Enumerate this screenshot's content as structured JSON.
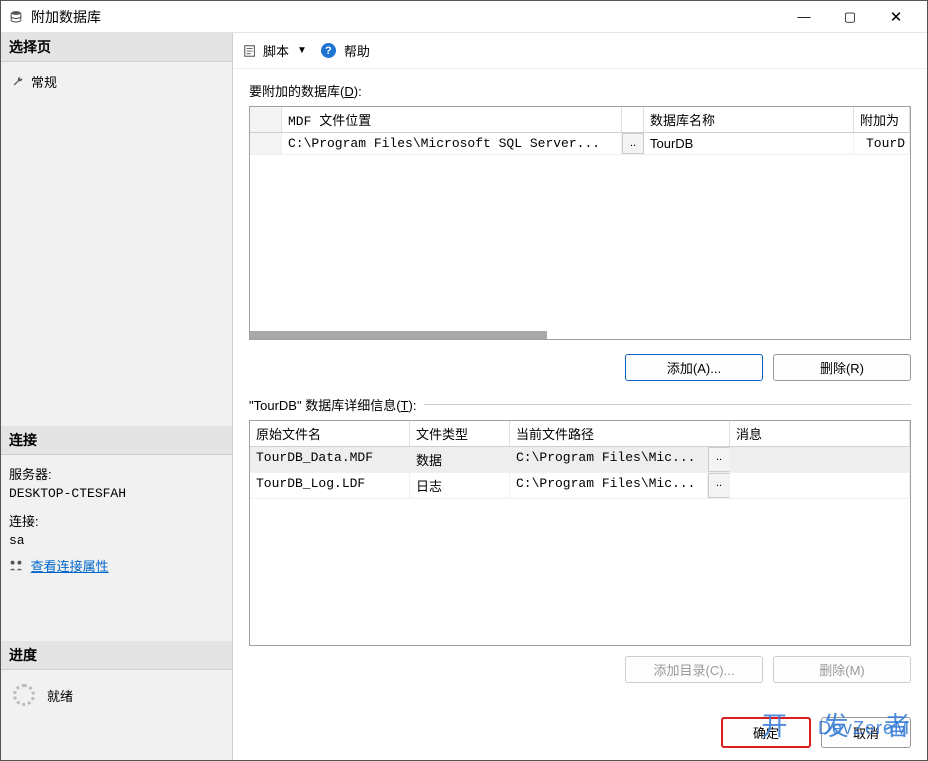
{
  "window": {
    "title": "附加数据库"
  },
  "sidebar": {
    "select_page_header": "选择页",
    "general_label": "常规",
    "connection_header": "连接",
    "server_label": "服务器:",
    "server_value": "DESKTOP-CTESFAH",
    "connection_label": "连接:",
    "connection_value": "sa",
    "view_conn_props": "查看连接属性",
    "progress_header": "进度",
    "progress_status": "就绪"
  },
  "toolbar": {
    "script_label": "脚本",
    "help_label": "帮助"
  },
  "main": {
    "databases_to_attach_label": "要附加的数据库(",
    "databases_to_attach_key": "D",
    "databases_to_attach_suffix": "):",
    "grid1": {
      "col_mdf": "MDF 文件位置",
      "col_dbname": "数据库名称",
      "col_attachas": "附加为",
      "rows": [
        {
          "mdf": "C:\\Program Files\\Microsoft SQL Server...",
          "dots": "..",
          "dbname": "TourDB",
          "attachas": "TourD"
        }
      ]
    },
    "add_button": "添加(A)...",
    "remove_button": "删除(R)",
    "details_prefix": "\"",
    "details_dbname": "TourDB",
    "details_label": "\" 数据库详细信息(",
    "details_key": "T",
    "details_suffix": "):",
    "grid2": {
      "col_orig": "原始文件名",
      "col_type": "文件类型",
      "col_path": "当前文件路径",
      "col_msg": "消息",
      "rows": [
        {
          "orig": "TourDB_Data.MDF",
          "type": "数据",
          "path": "C:\\Program Files\\Mic...",
          "dots": ".."
        },
        {
          "orig": "TourDB_Log.LDF",
          "type": "日志",
          "path": "C:\\Program Files\\Mic...",
          "dots": ".."
        }
      ]
    },
    "add_catalog_button": "添加目录(C)...",
    "remove2_button": "删除(M)"
  },
  "dialog": {
    "ok": "确定",
    "cancel": "取消"
  },
  "watermark": {
    "cn": "开 发 者",
    "en": "DevZeroM"
  }
}
